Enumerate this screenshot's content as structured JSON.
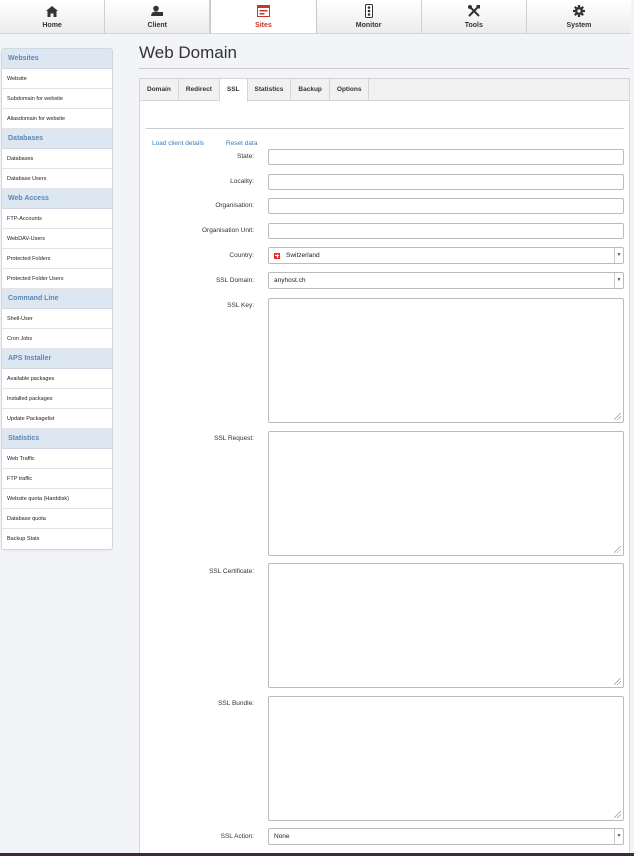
{
  "nav": [
    {
      "label": "Home",
      "icon": "home-icon"
    },
    {
      "label": "Client",
      "icon": "client-icon"
    },
    {
      "label": "Sites",
      "icon": "sites-icon",
      "active": true
    },
    {
      "label": "Monitor",
      "icon": "monitor-icon"
    },
    {
      "label": "Tools",
      "icon": "tools-icon"
    },
    {
      "label": "System",
      "icon": "gear-icon"
    }
  ],
  "sidebar": {
    "websites": {
      "title": "Websites",
      "items": [
        "Website",
        "Subdomain for website",
        "Aliasdomain for website"
      ]
    },
    "databases": {
      "title": "Databases",
      "items": [
        "Databases",
        "Database Users"
      ]
    },
    "web_access": {
      "title": "Web Access",
      "items": [
        "FTP-Accounts",
        "WebDAV-Users",
        "Protected Folders",
        "Protected Folder Users"
      ]
    },
    "command_line": {
      "title": "Command Line",
      "items": [
        "Shell-User",
        "Cron Jobs"
      ]
    },
    "aps_installer": {
      "title": "APS Installer",
      "items": [
        "Available packages",
        "Installed packages",
        "Update Packagelist"
      ]
    },
    "statistics": {
      "title": "Statistics",
      "items": [
        "Web Traffic",
        "FTP traffic",
        "Website quota (Harddisk)",
        "Database quota",
        "Backup Stats"
      ]
    }
  },
  "page": {
    "title": "Web Domain"
  },
  "tabs": [
    "Domain",
    "Redirect",
    "SSL",
    "Statistics",
    "Backup",
    "Options"
  ],
  "active_tab": "SSL",
  "links": {
    "load_client": "Load client details",
    "reset": "Reset data"
  },
  "form": {
    "state": {
      "label": "State:",
      "value": ""
    },
    "locality": {
      "label": "Locality:",
      "value": ""
    },
    "organisation": {
      "label": "Organisation:",
      "value": ""
    },
    "organisation_unit": {
      "label": "Organisation Unit:",
      "value": ""
    },
    "country": {
      "label": "Country:",
      "value": "Switzerland"
    },
    "ssl_domain": {
      "label": "SSL Domain:",
      "value": "anyhost.ch"
    },
    "ssl_key": {
      "label": "SSL Key:",
      "value": ""
    },
    "ssl_request": {
      "label": "SSL Request:",
      "value": ""
    },
    "ssl_certificate": {
      "label": "SSL Certificate:",
      "value": ""
    },
    "ssl_bundle": {
      "label": "SSL Bundle:",
      "value": ""
    },
    "ssl_action": {
      "label": "SSL Action:",
      "value": "None"
    }
  },
  "colors": {
    "accent": "#c0392b",
    "link": "#3a7bbf",
    "sidebar_header": "#5a86b8"
  }
}
